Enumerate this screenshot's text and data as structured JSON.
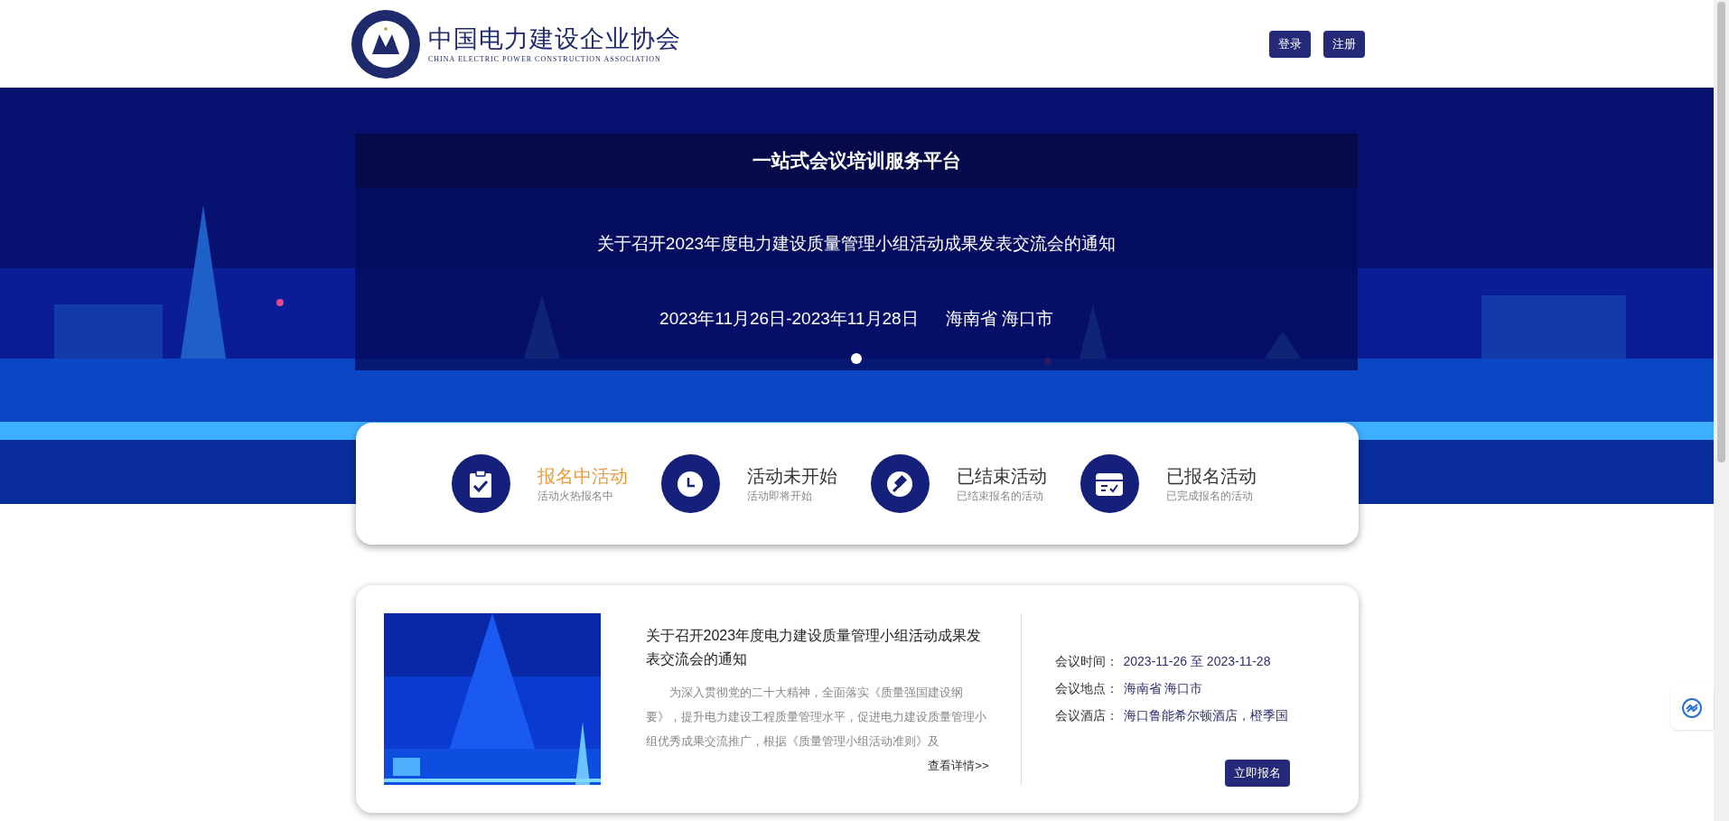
{
  "header": {
    "logo_title": "中国电力建设企业协会",
    "logo_subtitle": "CHINA ELECTRIC POWER CONSTRUCTION ASSOCIATION",
    "buttons": [
      "登录",
      "注册"
    ]
  },
  "banner": {
    "platform_title": "一站式会议培训服务平台",
    "headline": "关于召开2023年度电力建设质量管理小组活动成果发表交流会的通知",
    "date": "2023年11月26日-2023年11月28日",
    "place": "海南省 海口市",
    "slides": [
      {
        "selected": true
      }
    ]
  },
  "categories": [
    {
      "kind": "clipboard",
      "title": "报名中活动",
      "subtitle": "活动火热报名中",
      "selected": true
    },
    {
      "kind": "clock",
      "title": "活动未开始",
      "subtitle": "活动即将开始",
      "selected": false
    },
    {
      "kind": "gavel",
      "title": "已结束活动",
      "subtitle": "已结束报名的活动",
      "selected": false
    },
    {
      "kind": "box",
      "title": "已报名活动",
      "subtitle": "已完成报名的活动",
      "selected": false
    }
  ],
  "events": [
    {
      "thumbnail": {
        "kind": "picture"
      },
      "title": "关于召开2023年度电力建设质量管理小组活动成果发表交流会的通知",
      "summary": "为深入贯彻党的二十大精神，全面落实《质量强国建设纲要》，提升电力建设工程质量管理水平，促进电力建设质量管理小组优秀成果交流推广，根据《质量管理小组活动准则》及",
      "details_link": "查看详情>>",
      "fields": [
        {
          "label": "会议时间：",
          "value": "2023-11-26 至 2023-11-28"
        },
        {
          "label": "会议地点：",
          "value": "海南省 海口市"
        },
        {
          "label": "会议酒店：",
          "value": "海口鲁能希尔顿酒店，橙季国"
        }
      ],
      "register_button": "立即报名"
    }
  ]
}
